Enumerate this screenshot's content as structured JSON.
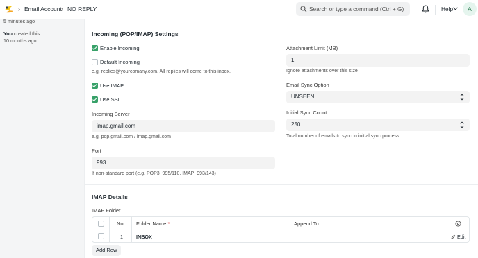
{
  "navbar": {
    "breadcrumbs": [
      "Email Account",
      "NO REPLY"
    ],
    "search_placeholder": "Search or type a command (Ctrl + G)",
    "help_label": "Help",
    "avatar_initial": "A"
  },
  "timeline": {
    "item1_time": "5 minutes ago",
    "item2_actor": "You",
    "item2_text": "created this",
    "item2_time": "10 months ago"
  },
  "incoming": {
    "title": "Incoming (POP/IMAP) Settings",
    "enable_incoming": {
      "label": "Enable Incoming",
      "checked": true
    },
    "default_incoming": {
      "label": "Default Incoming",
      "checked": false
    },
    "default_incoming_desc": "e.g. replies@yourcomany.com. All replies will come to this inbox.",
    "use_imap": {
      "label": "Use IMAP",
      "checked": true
    },
    "use_ssl": {
      "label": "Use SSL",
      "checked": true
    },
    "incoming_server_label": "Incoming Server",
    "incoming_server_value": "imap.gmail.com",
    "incoming_server_desc": "e.g. pop.gmail.com / imap.gmail.com",
    "port_label": "Port",
    "port_value": "993",
    "port_desc": "If non-standard port (e.g. POP3: 995/110, IMAP: 993/143)",
    "attachment_limit_label": "Attachment Limit (MB)",
    "attachment_limit_value": "1",
    "attachment_limit_desc": "Ignore attachments over this size",
    "sync_option_label": "Email Sync Option",
    "sync_option_value": "UNSEEN",
    "sync_count_label": "Initial Sync Count",
    "sync_count_value": "250",
    "sync_count_desc": "Total number of emails to sync in initial sync process"
  },
  "imap": {
    "title": "IMAP Details",
    "folder_label": "IMAP Folder",
    "columns": {
      "no": "No.",
      "folder_name": "Folder Name",
      "required_mark": "*",
      "append_to": "Append To"
    },
    "rows": [
      {
        "no": "1",
        "folder_name": "INBOX",
        "append_to": "",
        "edit": "Edit"
      }
    ],
    "add_row_label": "Add Row"
  },
  "colors": {
    "accent_green": "#38a169",
    "required_red": "#e03636"
  }
}
